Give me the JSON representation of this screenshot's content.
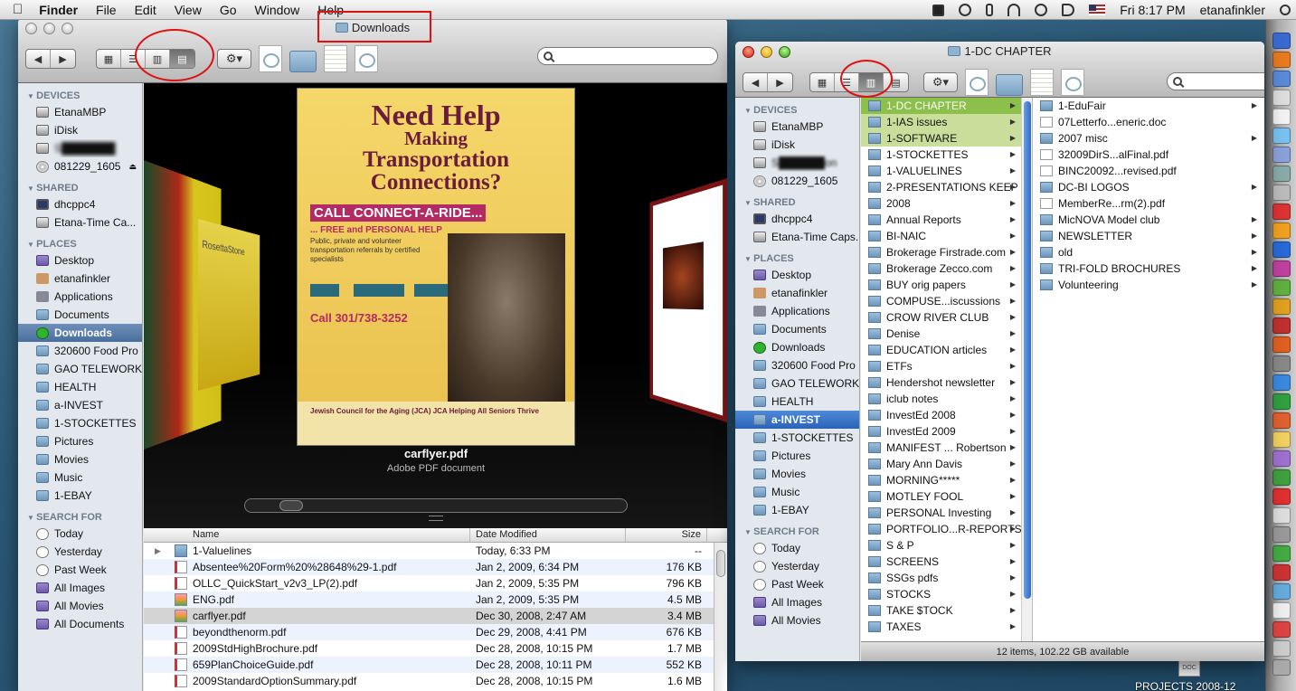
{
  "menubar": {
    "apple": "",
    "app": "Finder",
    "items": [
      "File",
      "Edit",
      "View",
      "Go",
      "Window",
      "Help"
    ],
    "clock": "Fri 8:17 PM",
    "user": "etanafinkler"
  },
  "win1": {
    "title": "Downloads",
    "search_placeholder": "",
    "sidebar": {
      "devices_head": "DEVICES",
      "devices": [
        "EtanaMBP",
        "iDisk",
        "S███████",
        "081229_1605"
      ],
      "shared_head": "SHARED",
      "shared": [
        "dhcppc4",
        "Etana-Time Ca..."
      ],
      "places_head": "PLACES",
      "places": [
        "Desktop",
        "etanafinkler",
        "Applications",
        "Documents",
        "Downloads",
        "320600 Food Pro",
        "GAO TELEWORK",
        "HEALTH",
        "a-INVEST",
        "1-STOCKETTES",
        "Pictures",
        "Movies",
        "Music",
        "1-EBAY"
      ],
      "search_head": "SEARCH FOR",
      "search": [
        "Today",
        "Yesterday",
        "Past Week",
        "All Images",
        "All Movies",
        "All Documents"
      ]
    },
    "coverflow": {
      "left_label": "RosettaStone",
      "poster": {
        "line1": "Need Help",
        "line2": "Making",
        "line3": "Transportation",
        "line4": "Connections?",
        "call": "CALL CONNECT-A-RIDE...",
        "free": "... FREE and PERSONAL HELP",
        "small": "Public, private and volunteer transportation referrals by certified specialists",
        "phone": "Call 301/738-3252",
        "foot": "Jewish Council for the Aging (JCA)  JCA  Helping All Seniors Thrive"
      },
      "caption_title": "carflyer.pdf",
      "caption_sub": "Adobe PDF document"
    },
    "list": {
      "headers": [
        "Name",
        "Date Modified",
        "Size"
      ],
      "rows": [
        {
          "name": "1-Valuelines",
          "date": "Today, 6:33 PM",
          "size": "--",
          "kind": "folder"
        },
        {
          "name": "Absentee%20Form%20%28648%29-1.pdf",
          "date": "Jan 2, 2009, 6:34 PM",
          "size": "176 KB",
          "kind": "pdf"
        },
        {
          "name": "OLLC_QuickStart_v2v3_LP(2).pdf",
          "date": "Jan 2, 2009, 5:35 PM",
          "size": "796 KB",
          "kind": "pdf"
        },
        {
          "name": "ENG.pdf",
          "date": "Jan 2, 2009, 5:35 PM",
          "size": "4.5 MB",
          "kind": "img"
        },
        {
          "name": "carflyer.pdf",
          "date": "Dec 30, 2008, 2:47 AM",
          "size": "3.4 MB",
          "kind": "img"
        },
        {
          "name": "beyondthenorm.pdf",
          "date": "Dec 29, 2008, 4:41 PM",
          "size": "676 KB",
          "kind": "pdf"
        },
        {
          "name": "2009StdHighBrochure.pdf",
          "date": "Dec 28, 2008, 10:15 PM",
          "size": "1.7 MB",
          "kind": "pdf"
        },
        {
          "name": "659PlanChoiceGuide.pdf",
          "date": "Dec 28, 2008, 10:11 PM",
          "size": "552 KB",
          "kind": "pdf"
        },
        {
          "name": "2009StandardOptionSummary.pdf",
          "date": "Dec 28, 2008, 10:15 PM",
          "size": "1.6 MB",
          "kind": "pdf"
        }
      ]
    }
  },
  "win2": {
    "title": "1-DC CHAPTER",
    "sidebar": {
      "devices_head": "DEVICES",
      "devices": [
        "EtanaMBP",
        "iDisk",
        "S██████on",
        "081229_1605"
      ],
      "shared_head": "SHARED",
      "shared": [
        "dhcppc4",
        "Etana-Time Caps..."
      ],
      "places_head": "PLACES",
      "places": [
        "Desktop",
        "etanafinkler",
        "Applications",
        "Documents",
        "Downloads",
        "320600 Food Pro",
        "GAO TELEWORK",
        "HEALTH",
        "a-INVEST",
        "1-STOCKETTES",
        "Pictures",
        "Movies",
        "Music",
        "1-EBAY"
      ],
      "search_head": "SEARCH FOR",
      "search": [
        "Today",
        "Yesterday",
        "Past Week",
        "All Images",
        "All Movies"
      ]
    },
    "col1": [
      "1-DC CHAPTER",
      "1-IAS issues",
      "1-SOFTWARE",
      "1-STOCKETTES",
      "1-VALUELINES",
      "2-PRESENTATIONS KEEP",
      "2008",
      "Annual Reports",
      "BI-NAIC",
      "Brokerage Firstrade.com",
      "Brokerage Zecco.com",
      "BUY orig papers",
      "COMPUSE...iscussions",
      "CROW RIVER CLUB",
      "Denise",
      "EDUCATION  articles",
      "ETFs",
      "Hendershot newsletter",
      "iclub notes",
      "InvestEd 2008",
      "InvestEd 2009",
      "MANIFEST ... Robertson",
      "Mary Ann Davis",
      "MORNING*****",
      "MOTLEY FOOL",
      "PERSONAL Investing",
      "PORTFOLIO...R-REPORTS",
      "S & P",
      "SCREENS",
      "SSGs pdfs",
      "STOCKS",
      "TAKE $TOCK",
      "TAXES"
    ],
    "col2": [
      {
        "name": "1-EduFair",
        "kind": "folder"
      },
      {
        "name": "07Letterfo...eneric.doc",
        "kind": "doc"
      },
      {
        "name": "2007 misc",
        "kind": "folder"
      },
      {
        "name": "32009DirS...alFinal.pdf",
        "kind": "doc"
      },
      {
        "name": "BINC20092...revised.pdf",
        "kind": "doc"
      },
      {
        "name": "DC-BI LOGOS",
        "kind": "folder"
      },
      {
        "name": "MemberRe...rm(2).pdf",
        "kind": "doc"
      },
      {
        "name": "MicNOVA Model club",
        "kind": "folder"
      },
      {
        "name": "NEWSLETTER",
        "kind": "folder"
      },
      {
        "name": "old",
        "kind": "folder"
      },
      {
        "name": "TRI-FOLD BROCHURES",
        "kind": "folder"
      },
      {
        "name": "Volunteering",
        "kind": "folder"
      }
    ],
    "status": "12 items, 102.22 GB available"
  },
  "desktop": {
    "file_label": "DOC",
    "label": "PROJECTS 2008-12"
  }
}
